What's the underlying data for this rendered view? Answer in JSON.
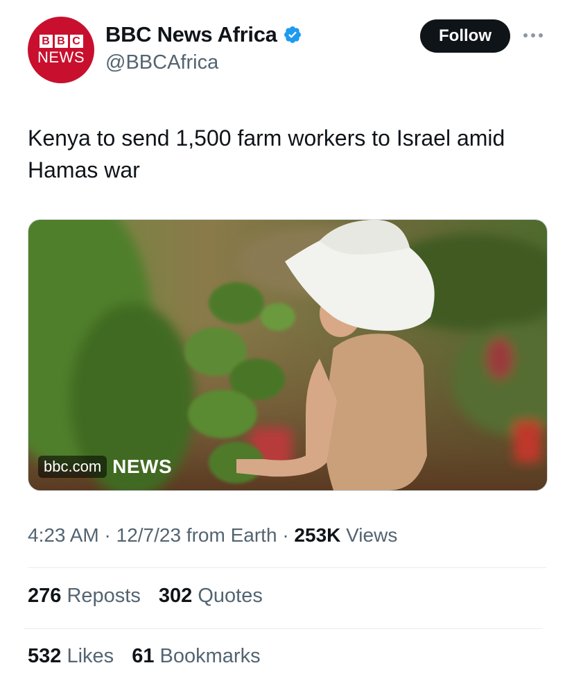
{
  "account": {
    "avatar_top": "BBC",
    "avatar_letters": [
      "B",
      "B",
      "C"
    ],
    "avatar_bottom": "NEWS",
    "display_name": "BBC News Africa",
    "handle": "@BBCAfrica",
    "verified": true,
    "verified_color": "#1d9bf0"
  },
  "actions": {
    "follow_label": "Follow",
    "more_icon": "more-horizontal-icon"
  },
  "tweet": {
    "text": "Kenya to send 1,500 farm workers to Israel amid Hamas war",
    "link_card": {
      "domain": "bbc.com",
      "logo_text": "NEWS"
    }
  },
  "meta": {
    "time": "4:23 AM",
    "date": "12/7/23",
    "source": "from Earth",
    "views_count": "253K",
    "views_label": "Views"
  },
  "stats": {
    "reposts_count": "276",
    "reposts_label": "Reposts",
    "quotes_count": "302",
    "quotes_label": "Quotes",
    "likes_count": "532",
    "likes_label": "Likes",
    "bookmarks_count": "61",
    "bookmarks_label": "Bookmarks"
  },
  "colors": {
    "brand_red": "#c8102e",
    "text_primary": "#0f1419",
    "text_secondary": "#536471",
    "follow_bg": "#0f1419"
  }
}
